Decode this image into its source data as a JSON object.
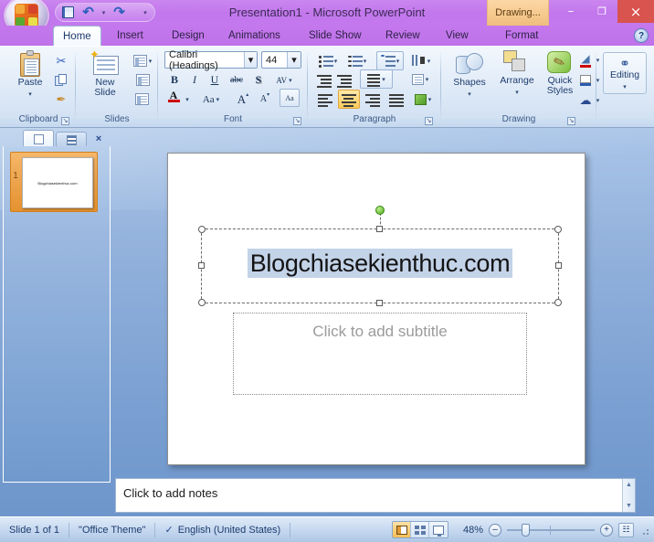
{
  "window": {
    "title": "Presentation1 - Microsoft PowerPoint",
    "contextual_tab": "Drawing...",
    "minimize": "–",
    "maximize": "❐",
    "close": "×"
  },
  "quick_access": {
    "save": "save-icon",
    "undo": "↶",
    "undo_caret": "▾",
    "redo": "↷",
    "customize": "▾"
  },
  "tabs": [
    {
      "label": "Home",
      "active": true
    },
    {
      "label": "Insert",
      "active": false
    },
    {
      "label": "Design",
      "active": false
    },
    {
      "label": "Animations",
      "active": false
    },
    {
      "label": "Slide Show",
      "active": false
    },
    {
      "label": "Review",
      "active": false
    },
    {
      "label": "View",
      "active": false
    },
    {
      "label": "Format",
      "active": false
    }
  ],
  "help": "?",
  "ribbon": {
    "groups": [
      {
        "name": "Clipboard",
        "label": "Clipboard"
      },
      {
        "name": "Slides",
        "label": "Slides"
      },
      {
        "name": "Font",
        "label": "Font"
      },
      {
        "name": "Paragraph",
        "label": "Paragraph"
      },
      {
        "name": "Drawing",
        "label": "Drawing"
      },
      {
        "name": "Editing",
        "label": ""
      }
    ],
    "clipboard": {
      "paste": "Paste",
      "paste_caret": "▾",
      "cut": "✂",
      "copy": "copy-icon",
      "format_painter": "✒"
    },
    "slides": {
      "new_slide_line1": "New",
      "new_slide_line2": "Slide",
      "new_slide_caret": "▾",
      "layout": "layout-icon",
      "layout_caret": "▾",
      "reset": "reset-icon",
      "delete": "✕"
    },
    "font": {
      "font_name": "Calibri (Headings)",
      "font_size": "44",
      "dropdown_caret": "▾",
      "bold": "B",
      "italic": "I",
      "underline": "U",
      "strikethrough": "abc",
      "shadow": "S",
      "spacing": "AV",
      "spacing_caret": "▾",
      "font_color": "A",
      "font_color_caret": "▾",
      "change_case": "Aa",
      "change_case_caret": "▾",
      "grow_font": "A",
      "shrink_font": "A",
      "clear_formatting": "Aa"
    },
    "paragraph": {
      "bullets": "bullets-icon",
      "bullets_caret": "▾",
      "numbering": "numbering-icon",
      "numbering_caret": "▾",
      "line_spacing": "line-spacing-icon",
      "line_spacing_caret": "▾",
      "text_direction": "text-direction-icon",
      "text_direction_caret": "▾",
      "decrease_indent": "decrease-indent-icon",
      "increase_indent": "increase-indent-icon",
      "columns": "columns-icon",
      "columns_caret": "▾",
      "align_text": "align-text-icon",
      "align_text_caret": "▾",
      "smartart": "smartart-icon",
      "smartart_caret": "▾",
      "align_left": "align-left-icon",
      "align_center": "align-center-icon",
      "align_right": "align-right-icon",
      "justify": "justify-icon"
    },
    "drawing": {
      "shapes": "Shapes",
      "shapes_caret": "▾",
      "arrange": "Arrange",
      "arrange_caret": "▾",
      "quick_styles_line1": "Quick",
      "quick_styles_line2": "Styles",
      "quick_styles_caret": "▾",
      "shape_fill": "shape-fill-icon",
      "shape_fill_caret": "▾",
      "shape_outline": "shape-outline-icon",
      "shape_outline_caret": "▾",
      "shape_effects": "shape-effects-icon",
      "shape_effects_caret": "▾"
    },
    "editing": {
      "label": "Editing",
      "caret": "▾",
      "icon": "find-binoculars-icon"
    },
    "dialog_launcher": "↘"
  },
  "slide_pane": {
    "tab_slides": "slides-tab-icon",
    "tab_outline": "outline-tab-icon",
    "close": "×",
    "thumbnails": [
      {
        "number": "1",
        "title": "Blogchiasekienthuc.com",
        "selected": true
      }
    ]
  },
  "slide": {
    "title_text": "Blogchiasekienthuc.com",
    "subtitle_placeholder": "Click to add subtitle",
    "rotation_handle": "rotation-handle"
  },
  "notes": {
    "placeholder": "Click to add notes",
    "scroll_up": "▲",
    "scroll_down": "▼"
  },
  "status": {
    "slide_count": "Slide 1 of 1",
    "theme": "\"Office Theme\"",
    "spell_check": "spell-check-icon",
    "language": "English (United States)",
    "view_normal": "normal-view-icon",
    "view_sorter": "slide-sorter-icon",
    "view_show": "slide-show-icon",
    "zoom_level": "48%",
    "zoom_out": "–",
    "zoom_in": "+",
    "fit_window": "fit-to-window-icon"
  },
  "colors": {
    "titlebar": "#c378ed",
    "ribbon": "#e2ecf8",
    "workspace": "#7ba0d2",
    "accent_orange": "#e5912f",
    "close_red": "#d9534f",
    "selection_blue": "#c3d3e8",
    "rotation_green": "#4fa81e"
  }
}
